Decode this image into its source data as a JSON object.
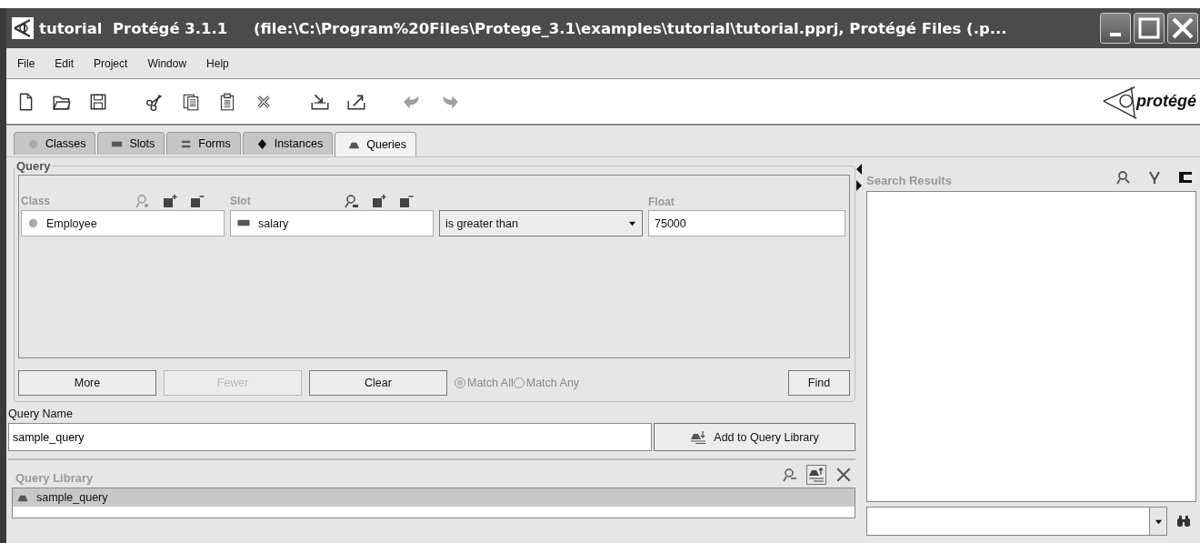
{
  "window": {
    "title": "tutorial  Protégé 3.1.1     (file:\\C:\\Program%20Files\\Protege_3.1\\examples\\tutorial\\tutorial.pprj, Protégé Files (.p..."
  },
  "menu": [
    "File",
    "Edit",
    "Project",
    "Window",
    "Help"
  ],
  "toolbar": [
    {
      "kind": "new",
      "disabled": false
    },
    {
      "kind": "open",
      "disabled": false
    },
    {
      "kind": "save",
      "disabled": false
    },
    {
      "kind": "cut",
      "disabled": false
    },
    {
      "kind": "copy",
      "disabled": false
    },
    {
      "kind": "paste",
      "disabled": false
    },
    {
      "kind": "delete",
      "disabled": false
    },
    {
      "kind": "import",
      "disabled": false
    },
    {
      "kind": "export",
      "disabled": false
    },
    {
      "kind": "undo",
      "disabled": true
    },
    {
      "kind": "redo",
      "disabled": true
    }
  ],
  "logo": "protégé",
  "tabs": [
    {
      "label": "Classes",
      "kind": "class",
      "selected": false
    },
    {
      "label": "Slots",
      "kind": "slot",
      "selected": false
    },
    {
      "label": "Forms",
      "kind": "form",
      "selected": false
    },
    {
      "label": "Instances",
      "kind": "instance",
      "selected": false
    },
    {
      "label": "Queries",
      "kind": "query",
      "selected": true
    }
  ],
  "query": {
    "title": "Query",
    "columns": [
      "Class",
      "Slot",
      "Float"
    ],
    "rows": [
      {
        "class": "Employee",
        "slot": "salary",
        "operator": "is greater than",
        "value": "75000"
      }
    ],
    "buttons": [
      {
        "label": "More",
        "disabled": false
      },
      {
        "label": "Fewer",
        "disabled": true
      },
      {
        "label": "Clear",
        "disabled": false
      }
    ],
    "match": [
      {
        "label": "Match All",
        "selected": true,
        "disabled": true
      },
      {
        "label": "Match Any",
        "selected": false,
        "disabled": true
      }
    ],
    "find_button": "Find"
  },
  "query_name": {
    "label": "Query Name",
    "value": "sample_query",
    "add_button": "Add to Query Library"
  },
  "query_library": {
    "title": "Query Library",
    "items": [
      {
        "label": "sample_query",
        "selected": true
      }
    ]
  },
  "search_results": {
    "title": "Search Results"
  }
}
